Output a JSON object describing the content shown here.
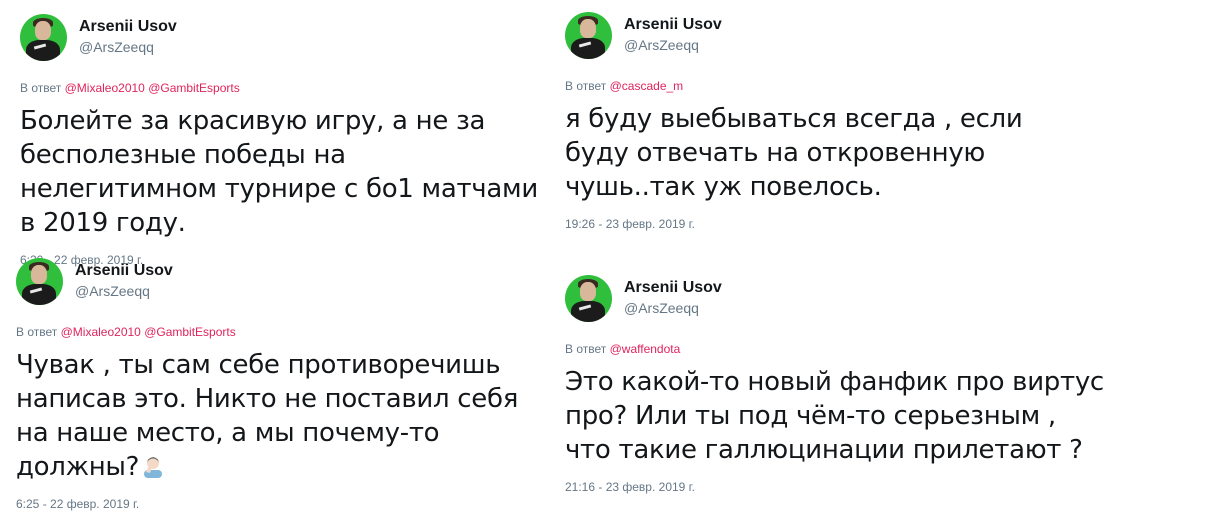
{
  "tweets": [
    {
      "name": "Arsenii Usov",
      "handle": "@ArsZeeqq",
      "reply_prefix": "В ответ",
      "mentions": [
        "@Mixaleo2010",
        "@GambitEsports"
      ],
      "text": "Болейте за красивую игру, а не за бесполезные победы на нелегитимном турнире с бо1 матчами в 2019 году.",
      "timestamp": "6:20 - 22 февр. 2019 г."
    },
    {
      "name": "Arsenii Usov",
      "handle": "@ArsZeeqq",
      "reply_prefix": "В ответ",
      "mentions": [
        "@cascade_m"
      ],
      "text": "я буду выебываться всегда , если буду отвечать на откровенную чушь..так уж повелось.",
      "timestamp": "19:26 - 23 февр. 2019 г."
    },
    {
      "name": "Arsenii Usov",
      "handle": "@ArsZeeqq",
      "reply_prefix": "В ответ",
      "mentions": [
        "@Mixaleo2010",
        "@GambitEsports"
      ],
      "text": "Чувак , ты сам себе противоречишь написав это. Никто не поставил себя на наше место, а мы почему-то должны?",
      "emoji": "facepalm",
      "timestamp": "6:25 - 22 февр. 2019 г."
    },
    {
      "name": "Arsenii Usov",
      "handle": "@ArsZeeqq",
      "reply_prefix": "В ответ",
      "mentions": [
        "@waffendota"
      ],
      "text": "Это какой-то новый фанфик про виртус про? Или ты под чём-то серьезным , что такие галлюцинации прилетают ?",
      "timestamp": "21:16 - 23 февр. 2019 г."
    }
  ],
  "colors": {
    "text": "#14171a",
    "muted": "#657786",
    "mention": "#e0245e",
    "avatar_bg": "#2fbf3c"
  }
}
